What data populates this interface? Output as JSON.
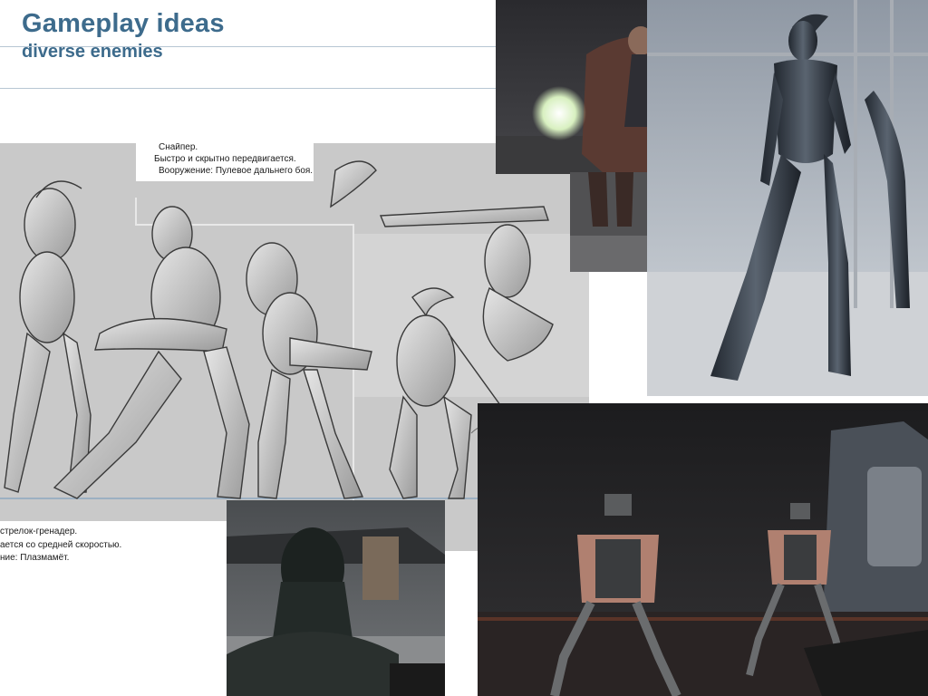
{
  "header": {
    "title": "Gameplay ideas",
    "subtitle": "diverse enemies"
  },
  "sketch_notes": {
    "sniper_role": "Снайпер.",
    "sniper_movement": "Быстро и скрытно передвигается.",
    "sniper_weapon": "Вооружение: Пулевое дальнего боя.",
    "grenadier_role": "стрелок-гренадер.",
    "grenadier_movement": "ается со средней скоростью.",
    "grenadier_weapon": "ние:  Плазмамёт."
  },
  "colors": {
    "title": "#3d6b8c",
    "rule": "#b7c6d3",
    "sketch_paper": "#c9c9c9"
  }
}
